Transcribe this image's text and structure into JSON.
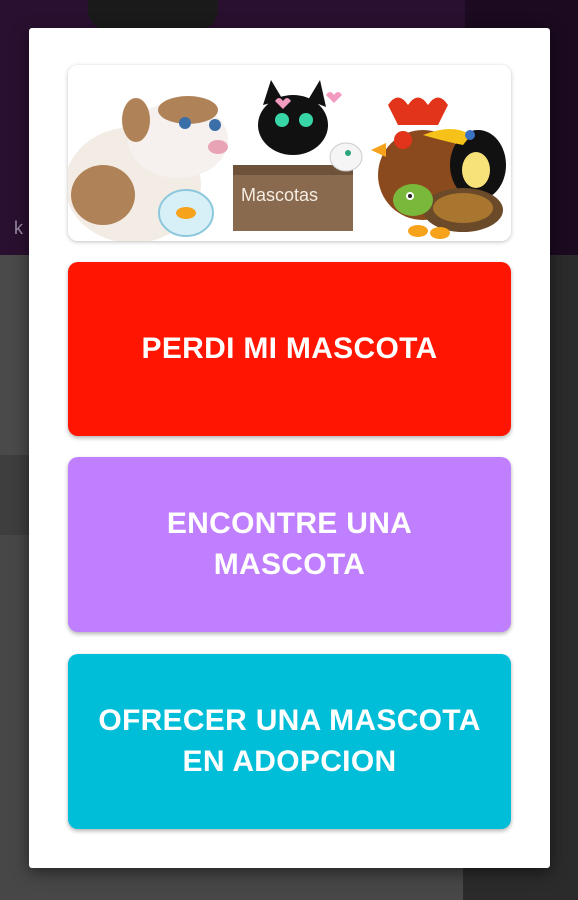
{
  "background": {
    "partial_text": "k"
  },
  "dialog": {
    "banner": {
      "label": "Mascotas",
      "icon": "pets-illustration"
    },
    "buttons": [
      {
        "lines": [
          "PERDI MI MASCOTA"
        ],
        "color": "#ff1500"
      },
      {
        "lines": [
          "ENCONTRE UNA",
          "MASCOTA"
        ],
        "color": "#c07ffe"
      },
      {
        "lines": [
          "OFRECER UNA MASCOTA",
          "EN ADOPCION"
        ],
        "color": "#00bdd8"
      }
    ]
  }
}
